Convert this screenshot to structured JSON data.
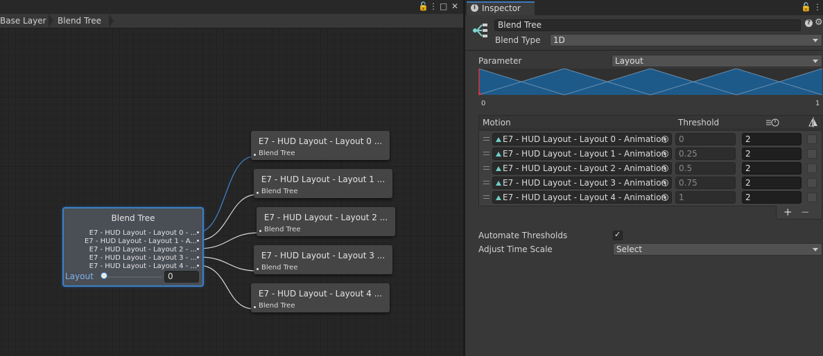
{
  "animator": {
    "breadcrumb": [
      "Base Layer",
      "Blend Tree"
    ],
    "blend_node": {
      "title": "Blend Tree",
      "rows": [
        "E7 - HUD Layout - Layout 0 - ...",
        "E7 - HUD Layout - Layout 1 - A...",
        "E7 - HUD Layout - Layout 2 - ...",
        "E7 - HUD Layout - Layout 3 - ...",
        "E7 - HUD Layout - Layout 4 - ..."
      ],
      "param_label": "Layout",
      "param_value": "0"
    },
    "child_nodes": [
      {
        "title": "E7 - HUD Layout - Layout 0 ...",
        "sub": "Blend Tree"
      },
      {
        "title": "E7 - HUD Layout - Layout 1 ...",
        "sub": "Blend Tree"
      },
      {
        "title": "E7 - HUD Layout - Layout 2 ...",
        "sub": "Blend Tree"
      },
      {
        "title": "E7 - HUD Layout - Layout 3 ...",
        "sub": "Blend Tree"
      },
      {
        "title": "E7 - HUD Layout - Layout 4 ...",
        "sub": "Blend Tree"
      }
    ]
  },
  "inspector": {
    "tab_label": "Inspector",
    "name": "Blend Tree",
    "blend_type_label": "Blend Type",
    "blend_type_value": "1D",
    "parameter_label": "Parameter",
    "parameter_value": "Layout",
    "graph_min": "0",
    "graph_max": "1",
    "motion_header": "Motion",
    "threshold_header": "Threshold",
    "motions": [
      {
        "clip": "E7 - HUD Layout - Layout 0 - Animation",
        "threshold": "0",
        "speed": "2"
      },
      {
        "clip": "E7 - HUD Layout - Layout 1 - Animation",
        "threshold": "0.25",
        "speed": "2"
      },
      {
        "clip": "E7 - HUD Layout - Layout 2 - Animation",
        "threshold": "0.5",
        "speed": "2"
      },
      {
        "clip": "E7 - HUD Layout - Layout 3 - Animation",
        "threshold": "0.75",
        "speed": "2"
      },
      {
        "clip": "E7 - HUD Layout - Layout 4 - Animation",
        "threshold": "1",
        "speed": "2"
      }
    ],
    "add_label": "+",
    "remove_label": "−",
    "automate_label": "Automate Thresholds",
    "automate_checked": true,
    "adjust_label": "Adjust Time Scale",
    "adjust_value": "Select"
  },
  "colors": {
    "accent": "#3f7fc4",
    "graph_fill": "#1d5a8a",
    "clip_icon": "#6fd0c8"
  }
}
